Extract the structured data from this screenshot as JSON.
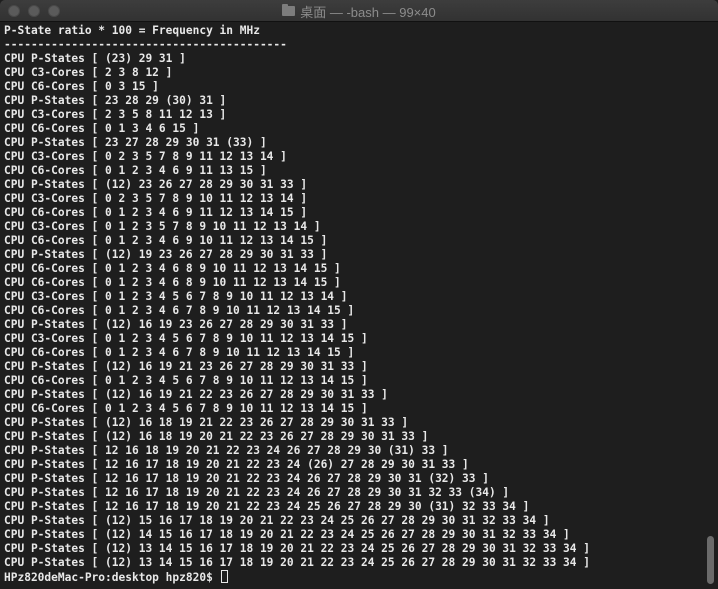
{
  "window": {
    "title": "桌面 — -bash — 99×40"
  },
  "terminal": {
    "lines": [
      "P-State ratio * 100 = Frequency in MHz",
      "------------------------------------------",
      "CPU P-States [ (23) 29 31 ]",
      "CPU C3-Cores [ 2 3 8 12 ]",
      "CPU C6-Cores [ 0 3 15 ]",
      "CPU P-States [ 23 28 29 (30) 31 ]",
      "CPU C3-Cores [ 2 3 5 8 11 12 13 ]",
      "CPU C6-Cores [ 0 1 3 4 6 15 ]",
      "CPU P-States [ 23 27 28 29 30 31 (33) ]",
      "CPU C3-Cores [ 0 2 3 5 7 8 9 11 12 13 14 ]",
      "CPU C6-Cores [ 0 1 2 3 4 6 9 11 13 15 ]",
      "CPU P-States [ (12) 23 26 27 28 29 30 31 33 ]",
      "CPU C3-Cores [ 0 2 3 5 7 8 9 10 11 12 13 14 ]",
      "CPU C6-Cores [ 0 1 2 3 4 6 9 11 12 13 14 15 ]",
      "CPU C3-Cores [ 0 1 2 3 5 7 8 9 10 11 12 13 14 ]",
      "CPU C6-Cores [ 0 1 2 3 4 6 9 10 11 12 13 14 15 ]",
      "CPU P-States [ (12) 19 23 26 27 28 29 30 31 33 ]",
      "CPU C6-Cores [ 0 1 2 3 4 6 8 9 10 11 12 13 14 15 ]",
      "CPU C6-Cores [ 0 1 2 3 4 6 8 9 10 11 12 13 14 15 ]",
      "CPU C3-Cores [ 0 1 2 3 4 5 6 7 8 9 10 11 12 13 14 ]",
      "CPU C6-Cores [ 0 1 2 3 4 6 7 8 9 10 11 12 13 14 15 ]",
      "CPU P-States [ (12) 16 19 23 26 27 28 29 30 31 33 ]",
      "CPU C3-Cores [ 0 1 2 3 4 5 6 7 8 9 10 11 12 13 14 15 ]",
      "CPU C6-Cores [ 0 1 2 3 4 6 7 8 9 10 11 12 13 14 15 ]",
      "CPU P-States [ (12) 16 19 21 23 26 27 28 29 30 31 33 ]",
      "CPU C6-Cores [ 0 1 2 3 4 5 6 7 8 9 10 11 12 13 14 15 ]",
      "CPU P-States [ (12) 16 19 21 22 23 26 27 28 29 30 31 33 ]",
      "CPU C6-Cores [ 0 1 2 3 4 5 6 7 8 9 10 11 12 13 14 15 ]",
      "CPU P-States [ (12) 16 18 19 21 22 23 26 27 28 29 30 31 33 ]",
      "CPU P-States [ (12) 16 18 19 20 21 22 23 26 27 28 29 30 31 33 ]",
      "CPU P-States [ 12 16 18 19 20 21 22 23 24 26 27 28 29 30 (31) 33 ]",
      "CPU P-States [ 12 16 17 18 19 20 21 22 23 24 (26) 27 28 29 30 31 33 ]",
      "CPU P-States [ 12 16 17 18 19 20 21 22 23 24 26 27 28 29 30 31 (32) 33 ]",
      "CPU P-States [ 12 16 17 18 19 20 21 22 23 24 26 27 28 29 30 31 32 33 (34) ]",
      "CPU P-States [ 12 16 17 18 19 20 21 22 23 24 25 26 27 28 29 30 (31) 32 33 34 ]",
      "CPU P-States [ (12) 15 16 17 18 19 20 21 22 23 24 25 26 27 28 29 30 31 32 33 34 ]",
      "CPU P-States [ (12) 14 15 16 17 18 19 20 21 22 23 24 25 26 27 28 29 30 31 32 33 34 ]",
      "CPU P-States [ (12) 13 14 15 16 17 18 19 20 21 22 23 24 25 26 27 28 29 30 31 32 33 34 ]",
      "CPU P-States [ (12) 13 14 15 16 17 18 19 20 21 22 23 24 25 26 27 28 29 30 31 32 33 34 ]"
    ],
    "prompt": "HPz820deMac-Pro:desktop hpz820$ "
  }
}
